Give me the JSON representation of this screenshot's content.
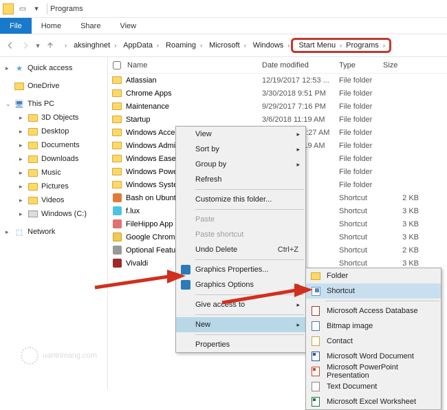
{
  "title": "Programs",
  "ribbon": {
    "file": "File",
    "tabs": [
      "Home",
      "Share",
      "View"
    ]
  },
  "breadcrumbs": [
    "aksinghnet",
    "AppData",
    "Roaming",
    "Microsoft",
    "Windows",
    "Start Menu",
    "Programs"
  ],
  "highlight_crumbs_from_index": 5,
  "columns": {
    "name": "Name",
    "date": "Date modified",
    "type": "Type",
    "size": "Size"
  },
  "sidebar": {
    "quick": {
      "label": "Quick access"
    },
    "onedrive": {
      "label": "OneDrive"
    },
    "thispc": {
      "label": "This PC",
      "children": [
        "3D Objects",
        "Desktop",
        "Documents",
        "Downloads",
        "Music",
        "Pictures",
        "Videos",
        "Windows (C:)"
      ]
    },
    "network": {
      "label": "Network"
    }
  },
  "files": [
    {
      "icon": "folder",
      "name": "Atlassian",
      "date": "12/19/2017 12:53 ...",
      "type": "File folder",
      "size": ""
    },
    {
      "icon": "folder",
      "name": "Chrome Apps",
      "date": "3/30/2018 9:51 PM",
      "type": "File folder",
      "size": ""
    },
    {
      "icon": "folder",
      "name": "Maintenance",
      "date": "9/29/2017 7:16 PM",
      "type": "File folder",
      "size": ""
    },
    {
      "icon": "folder",
      "name": "Startup",
      "date": "3/6/2018 11:19 AM",
      "type": "File folder",
      "size": ""
    },
    {
      "icon": "folder",
      "name": "Windows Accessories",
      "date": "12/19/2017 1:27 AM",
      "type": "File folder",
      "size": ""
    },
    {
      "icon": "folder",
      "name": "Windows Administrative Tools",
      "date": "3/6/2018 11:19 AM",
      "type": "File folder",
      "size": ""
    },
    {
      "icon": "folder",
      "name": "Windows Ease of A",
      "date": "",
      "type": "File folder",
      "size": ""
    },
    {
      "icon": "folder",
      "name": "Windows PowerSh",
      "date": "",
      "type": "File folder",
      "size": ""
    },
    {
      "icon": "folder",
      "name": "Windows System",
      "date": "",
      "type": "File folder",
      "size": ""
    },
    {
      "icon": "app-a",
      "name": "Bash on Ubuntu or",
      "date": "",
      "type": "Shortcut",
      "size": "2 KB"
    },
    {
      "icon": "app-b",
      "name": "f.lux",
      "date": "",
      "type": "Shortcut",
      "size": "3 KB"
    },
    {
      "icon": "app-c",
      "name": "FileHippo App Mar",
      "date": "",
      "type": "Shortcut",
      "size": "3 KB"
    },
    {
      "icon": "app-d",
      "name": "Google Chrome Ca",
      "date": "",
      "type": "Shortcut",
      "size": "3 KB"
    },
    {
      "icon": "app-e",
      "name": "Optional Features",
      "date": "",
      "type": "Shortcut",
      "size": "2 KB"
    },
    {
      "icon": "app-f",
      "name": "Vivaldi",
      "date": "",
      "type": "Shortcut",
      "size": "3 KB"
    }
  ],
  "context_menu": [
    {
      "label": "View",
      "sub": true
    },
    {
      "label": "Sort by",
      "sub": true
    },
    {
      "label": "Group by",
      "sub": true
    },
    {
      "label": "Refresh"
    },
    {
      "sep": true
    },
    {
      "label": "Customize this folder..."
    },
    {
      "sep": true
    },
    {
      "label": "Paste",
      "disabled": true
    },
    {
      "label": "Paste shortcut",
      "disabled": true
    },
    {
      "label": "Undo Delete",
      "shortcut": "Ctrl+Z"
    },
    {
      "sep": true
    },
    {
      "label": "Graphics Properties...",
      "icon": "intel"
    },
    {
      "label": "Graphics Options",
      "icon": "intel",
      "sub": true
    },
    {
      "sep": true
    },
    {
      "label": "Give access to",
      "sub": true
    },
    {
      "sep": true
    },
    {
      "label": "New",
      "sub": true,
      "highlight": true
    },
    {
      "sep": true
    },
    {
      "label": "Properties"
    }
  ],
  "new_submenu": [
    {
      "label": "Folder",
      "icon": "fold"
    },
    {
      "label": "Shortcut",
      "icon": "sc",
      "highlight": true
    },
    {
      "sep": true
    },
    {
      "label": "Microsoft Access Database",
      "icon": "a"
    },
    {
      "label": "Bitmap image",
      "icon": "b"
    },
    {
      "label": "Contact",
      "icon": "c"
    },
    {
      "label": "Microsoft Word Document",
      "icon": "w"
    },
    {
      "label": "Microsoft PowerPoint Presentation",
      "icon": "p"
    },
    {
      "label": "Text Document",
      "icon": "t"
    },
    {
      "label": "Microsoft Excel Worksheet",
      "icon": "x"
    }
  ],
  "watermark": "uantrimang"
}
